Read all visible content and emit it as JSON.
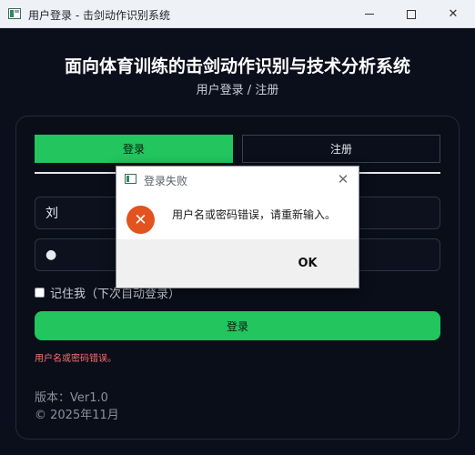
{
  "window": {
    "title": "用户登录 - 击剑动作识别系统",
    "minimize_glyph": "",
    "maximize_glyph": "",
    "close_glyph": "✕"
  },
  "header": {
    "title": "面向体育训练的击剑动作识别与技术分析系统",
    "subtitle": "用户登录 / 注册"
  },
  "tabs": {
    "login": "登录",
    "register": "注册",
    "active": "login"
  },
  "form": {
    "username_value": "刘",
    "password_value": "●",
    "remember_label": "记住我（下次自动登录）",
    "remember_checked": false,
    "login_button": "登录",
    "error_message": "用户名或密码错误。"
  },
  "footer": {
    "version": "版本：Ver1.0",
    "copyright": "© 2025年11月"
  },
  "dialog": {
    "title": "登录失败",
    "message": "用户名或密码错误，请重新输入。",
    "ok_button": "OK",
    "close_glyph": "✕",
    "error_glyph": "✕"
  },
  "colors": {
    "accent": "#22c55e",
    "background": "#0b0f1c",
    "error": "#f87171",
    "error_icon": "#e2531f"
  },
  "icons": {
    "app": "app-icon",
    "dialog_error": "error-icon"
  }
}
